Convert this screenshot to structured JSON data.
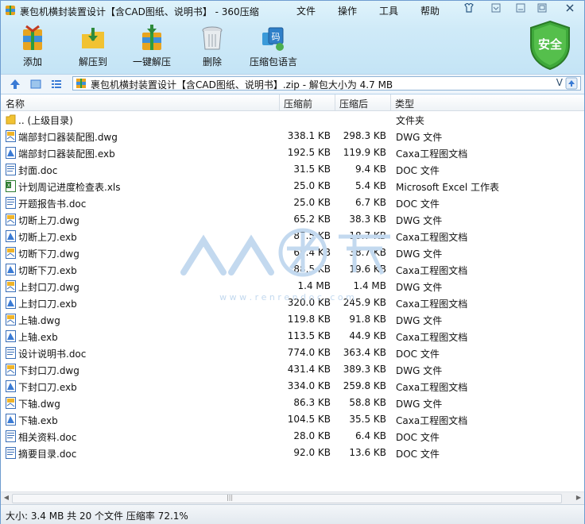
{
  "window": {
    "title": "裹包机横封装置设计【含CAD图纸、说明书】 - 360压缩"
  },
  "menu": [
    "文件",
    "操作",
    "工具",
    "帮助"
  ],
  "window_controls": {
    "skin": "皮肤",
    "minimize": "最小化",
    "maximize": "最大化",
    "close": "关闭"
  },
  "toolbar": {
    "add": "添加",
    "extract_to": "解压到",
    "one_click_extract": "一键解压",
    "delete": "删除",
    "comment": "压缩包语言"
  },
  "security_badge": "安全",
  "address": {
    "path": "裹包机横封装置设计【含CAD图纸、说明书】.zip - 解包大小为 4.7 MB"
  },
  "columns": {
    "name": "名称",
    "size": "压缩前",
    "packed": "压缩后",
    "type": "类型"
  },
  "files": [
    {
      "name": ".. (上级目录)",
      "size": "",
      "packed": "",
      "type": "文件夹",
      "icon": "folder-icon"
    },
    {
      "name": "端部封口器装配图.dwg",
      "size": "338.1 KB",
      "packed": "298.3 KB",
      "type": "DWG 文件",
      "icon": "dwg-file-icon"
    },
    {
      "name": "端部封口器装配图.exb",
      "size": "192.5 KB",
      "packed": "119.9 KB",
      "type": "Caxa工程图文档",
      "icon": "exb-file-icon"
    },
    {
      "name": "封面.doc",
      "size": "31.5 KB",
      "packed": "9.4 KB",
      "type": "DOC 文件",
      "icon": "doc-file-icon"
    },
    {
      "name": "计划周记进度检查表.xls",
      "size": "25.0 KB",
      "packed": "5.4 KB",
      "type": "Microsoft Excel 工作表",
      "icon": "xls-file-icon"
    },
    {
      "name": "开题报告书.doc",
      "size": "25.0 KB",
      "packed": "6.7 KB",
      "type": "DOC 文件",
      "icon": "doc-file-icon"
    },
    {
      "name": "切断上刀.dwg",
      "size": "65.2 KB",
      "packed": "38.3 KB",
      "type": "DWG 文件",
      "icon": "dwg-file-icon"
    },
    {
      "name": "切断上刀.exb",
      "size": "87.5 KB",
      "packed": "18.7 KB",
      "type": "Caxa工程图文档",
      "icon": "exb-file-icon"
    },
    {
      "name": "切断下刀.dwg",
      "size": "65.4 KB",
      "packed": "38.7 KB",
      "type": "DWG 文件",
      "icon": "dwg-file-icon"
    },
    {
      "name": "切断下刀.exb",
      "size": "88.5 KB",
      "packed": "19.6 KB",
      "type": "Caxa工程图文档",
      "icon": "exb-file-icon"
    },
    {
      "name": "上封口刀.dwg",
      "size": "1.4 MB",
      "packed": "1.4 MB",
      "type": "DWG 文件",
      "icon": "dwg-file-icon"
    },
    {
      "name": "上封口刀.exb",
      "size": "320.0 KB",
      "packed": "245.9 KB",
      "type": "Caxa工程图文档",
      "icon": "exb-file-icon"
    },
    {
      "name": "上轴.dwg",
      "size": "119.8 KB",
      "packed": "91.8 KB",
      "type": "DWG 文件",
      "icon": "dwg-file-icon"
    },
    {
      "name": "上轴.exb",
      "size": "113.5 KB",
      "packed": "44.9 KB",
      "type": "Caxa工程图文档",
      "icon": "exb-file-icon"
    },
    {
      "name": "设计说明书.doc",
      "size": "774.0 KB",
      "packed": "363.4 KB",
      "type": "DOC 文件",
      "icon": "doc-file-icon"
    },
    {
      "name": "下封口刀.dwg",
      "size": "431.4 KB",
      "packed": "389.3 KB",
      "type": "DWG 文件",
      "icon": "dwg-file-icon"
    },
    {
      "name": "下封口刀.exb",
      "size": "334.0 KB",
      "packed": "259.8 KB",
      "type": "Caxa工程图文档",
      "icon": "exb-file-icon"
    },
    {
      "name": "下轴.dwg",
      "size": "86.3 KB",
      "packed": "58.8 KB",
      "type": "DWG 文件",
      "icon": "dwg-file-icon"
    },
    {
      "name": "下轴.exb",
      "size": "104.5 KB",
      "packed": "35.5 KB",
      "type": "Caxa工程图文档",
      "icon": "exb-file-icon"
    },
    {
      "name": "相关资料.doc",
      "size": "28.0 KB",
      "packed": "6.4 KB",
      "type": "DOC 文件",
      "icon": "doc-file-icon"
    },
    {
      "name": "摘要目录.doc",
      "size": "92.0 KB",
      "packed": "13.6 KB",
      "type": "DOC 文件",
      "icon": "doc-file-icon"
    }
  ],
  "status": {
    "text": "大小: 3.4 MB 共 20 个文件 压缩率 72.1%"
  },
  "watermark": {
    "logo_text": "人人文库",
    "url": "w w w . r e n r e n d o c . c o m"
  },
  "colors": {
    "accent": "#3a7bd5",
    "shield_green": "#3ea83a"
  }
}
